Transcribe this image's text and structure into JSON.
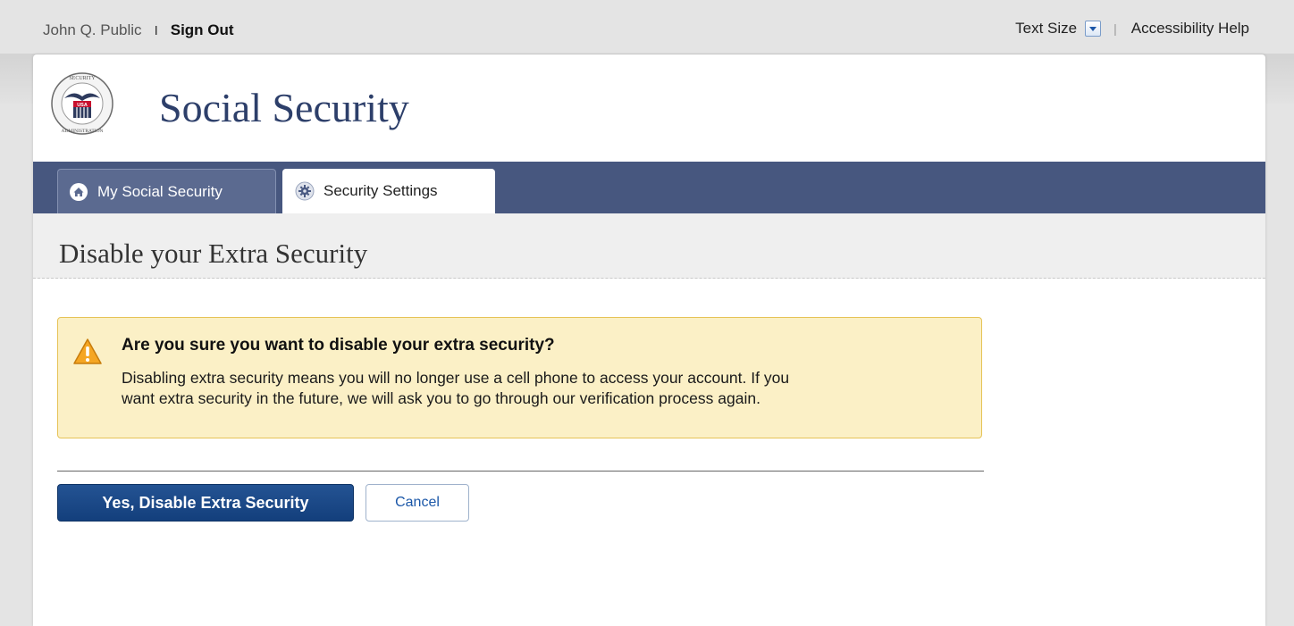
{
  "topbar": {
    "user_name": "John Q. Public",
    "separator": "I",
    "sign_out": "Sign Out",
    "text_size_label": "Text Size",
    "util_separator": "|",
    "accessibility_help": "Accessibility Help"
  },
  "header": {
    "site_title": "Social Security",
    "logo_text": "SOCIAL SECURITY ADMINISTRATION USA"
  },
  "nav": {
    "tabs": [
      {
        "label": "My Social Security",
        "icon": "home-icon",
        "active": false
      },
      {
        "label": "Security Settings",
        "icon": "gear-icon",
        "active": true
      }
    ]
  },
  "page": {
    "title": "Disable your Extra Security"
  },
  "alert": {
    "icon": "warning-icon",
    "heading": "Are you sure you want to disable your extra security?",
    "body_line1": "Disabling extra security means you will no longer use a cell phone to access your account. If you",
    "body_line2": "want extra security in the future, we will ask you to go through our verification process again."
  },
  "actions": {
    "confirm_label": "Yes, Disable Extra Security",
    "cancel_label": "Cancel"
  },
  "colors": {
    "nav_bar": "#47577f",
    "primary_button": "#1a4a8a",
    "alert_background": "#fbf0c6",
    "alert_border": "#e6c357",
    "title_text": "#2d3f6a"
  }
}
